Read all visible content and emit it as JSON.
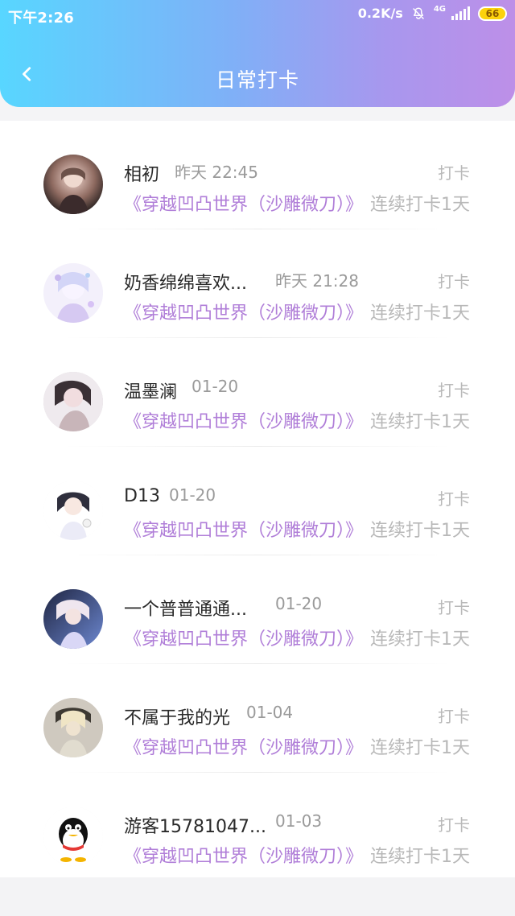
{
  "status_bar": {
    "time": "下午2:26",
    "net_speed": "0.2K/s",
    "network": "4G",
    "battery": "66"
  },
  "navbar": {
    "title": "日常打卡"
  },
  "checkins": [
    {
      "name": "相初",
      "time": "昨天 22:45",
      "action": "打卡",
      "book": "《穿越凹凸世界（沙雕微刀）》",
      "streak": "连续打卡1天"
    },
    {
      "name": "奶香绵绵喜欢...",
      "time": "昨天 21:28",
      "action": "打卡",
      "book": "《穿越凹凸世界（沙雕微刀）》",
      "streak": "连续打卡1天"
    },
    {
      "name": "温墨澜",
      "time": "01-20",
      "action": "打卡",
      "book": "《穿越凹凸世界（沙雕微刀）》",
      "streak": "连续打卡1天"
    },
    {
      "name": "D13",
      "time": "01-20",
      "action": "打卡",
      "book": "《穿越凹凸世界（沙雕微刀）》",
      "streak": "连续打卡1天"
    },
    {
      "name": "一个普普通通...",
      "time": "01-20",
      "action": "打卡",
      "book": "《穿越凹凸世界（沙雕微刀）》",
      "streak": "连续打卡1天"
    },
    {
      "name": "不属于我的光",
      "time": "01-04",
      "action": "打卡",
      "book": "《穿越凹凸世界（沙雕微刀）》",
      "streak": "连续打卡1天"
    },
    {
      "name": "游客15781047...",
      "time": "01-03",
      "action": "打卡",
      "book": "《穿越凹凸世界（沙雕微刀）》",
      "streak": "连续打卡1天"
    }
  ],
  "icons": {
    "back": "chevron-left-icon",
    "mute": "bell-off-icon",
    "signal": "signal-icon",
    "battery": "battery-icon"
  },
  "colors": {
    "header_start": "#58d6ff",
    "header_end": "#bd8fe8",
    "book_text": "#b07ed8",
    "muted_text": "#b8b8b8",
    "name_text": "#2a2a2a"
  }
}
